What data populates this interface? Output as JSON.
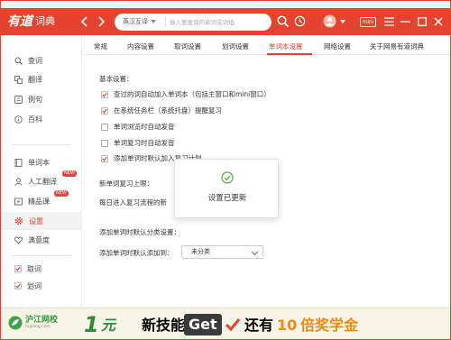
{
  "colors": {
    "brand": "#e5432e",
    "ad_green": "#2e8b37",
    "ad_orange": "#ee8a12"
  },
  "app": {
    "logo_mark": "有道",
    "logo_text": "词典",
    "icons": [
      "back-arrow-icon",
      "forward-arrow-icon",
      "user-avatar-icon",
      "user-dropdown-icon",
      "mini-mode-icon",
      "history-clock-icon",
      "menu-icon",
      "minimize-icon",
      "maximize-icon",
      "close-icon"
    ]
  },
  "search": {
    "mode": "英汉互译",
    "placeholder": "输入要查询的单词或词组"
  },
  "toolbar": {
    "mini_label": "mini"
  },
  "sidebar": {
    "items": [
      {
        "label": "查词",
        "icon": "search-icon"
      },
      {
        "label": "翻译",
        "icon": "translate-icon"
      },
      {
        "label": "例句",
        "icon": "example-sentence-icon"
      },
      {
        "label": "百科",
        "icon": "encyclopedia-icon"
      },
      {
        "label": "单词本",
        "icon": "wordbook-icon"
      },
      {
        "label": "人工翻译",
        "icon": "human-translation-icon",
        "badge": "NEW"
      },
      {
        "label": "精品课",
        "icon": "course-icon",
        "badge": "NEW"
      },
      {
        "label": "设置",
        "icon": "settings-icon",
        "active": true
      },
      {
        "label": "满意度",
        "icon": "heart-icon"
      },
      {
        "label": "取词",
        "icon": "checkbox-icon",
        "checked": true
      },
      {
        "label": "划词",
        "icon": "checkbox-icon",
        "checked": true
      }
    ]
  },
  "tabs": [
    {
      "label": "常规"
    },
    {
      "label": "内容设置"
    },
    {
      "label": "取词设置"
    },
    {
      "label": "划词设置"
    },
    {
      "label": "单词本设置",
      "active": true
    },
    {
      "label": "网络设置"
    },
    {
      "label": "关于网易有道词典"
    }
  ],
  "settings": {
    "basic_title": "基本设置：",
    "options": [
      {
        "label": "查过的词自动加入单词本（包括主窗口和mini窗口）",
        "checked": true
      },
      {
        "label": "在系统任务栏（系统托盘）提醒复习",
        "checked": true
      },
      {
        "label": "单词浏览时自动发音",
        "checked": false
      },
      {
        "label": "单词复习时自动发音",
        "checked": false
      },
      {
        "label": "添加单词时默认加入复习计划",
        "checked": true
      }
    ],
    "review_limit_title": "新单词复习上限：",
    "review_limit_text": "每日进入复习流程的新",
    "category_title": "添加单词时默认分类设置：",
    "category_label": "添加单词时默认添加到：",
    "category_value": "未分类"
  },
  "toast": {
    "message": "设置已更新"
  },
  "ad": {
    "logo_main": "沪江网校",
    "logo_sub": "hujiang.com",
    "num": "1",
    "t1": "元",
    "t2": "新技能",
    "get": "Get",
    "t3": "还有",
    "t4": "10",
    "t5": "倍奖学金"
  }
}
